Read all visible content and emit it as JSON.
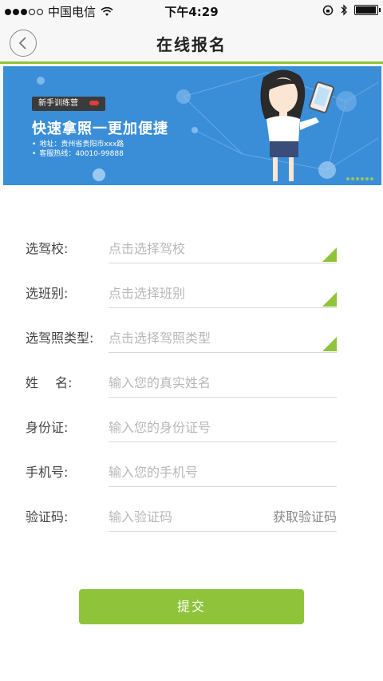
{
  "status_bar": {
    "carrier": "中国电信",
    "time": "下午4:29",
    "signal_bars_filled": 3,
    "signal_bars_total": 5,
    "battery_level": 0.95
  },
  "nav": {
    "title": "在线报名",
    "back_icon": "chevron-left-icon"
  },
  "banner": {
    "tag": "新手训练营",
    "title": "快速拿照一更加便捷",
    "address": "地址：贵州省贵阳市xxx路",
    "hotline": "客服热线：40010-99888"
  },
  "form": {
    "rows": [
      {
        "label": "选驾校:",
        "placeholder": "点击选择驾校",
        "dropdown": true
      },
      {
        "label": "选班别:",
        "placeholder": "点击选择班别",
        "dropdown": true
      },
      {
        "label": "选驾照类型:",
        "placeholder": "点击选择驾照类型",
        "dropdown": true
      },
      {
        "label": "姓　 名:",
        "placeholder": "输入您的真实姓名",
        "dropdown": false
      },
      {
        "label": "身份证:",
        "placeholder": "输入您的身份证号",
        "dropdown": false
      },
      {
        "label": "手机号:",
        "placeholder": "输入您的手机号",
        "dropdown": false
      },
      {
        "label": "验证码:",
        "placeholder": "输入验证码",
        "dropdown": false
      }
    ],
    "get_code_label": "获取验证码",
    "submit_label": "提交"
  },
  "colors": {
    "accent": "#8fc43a",
    "banner_bg": "#3a8ed8"
  }
}
